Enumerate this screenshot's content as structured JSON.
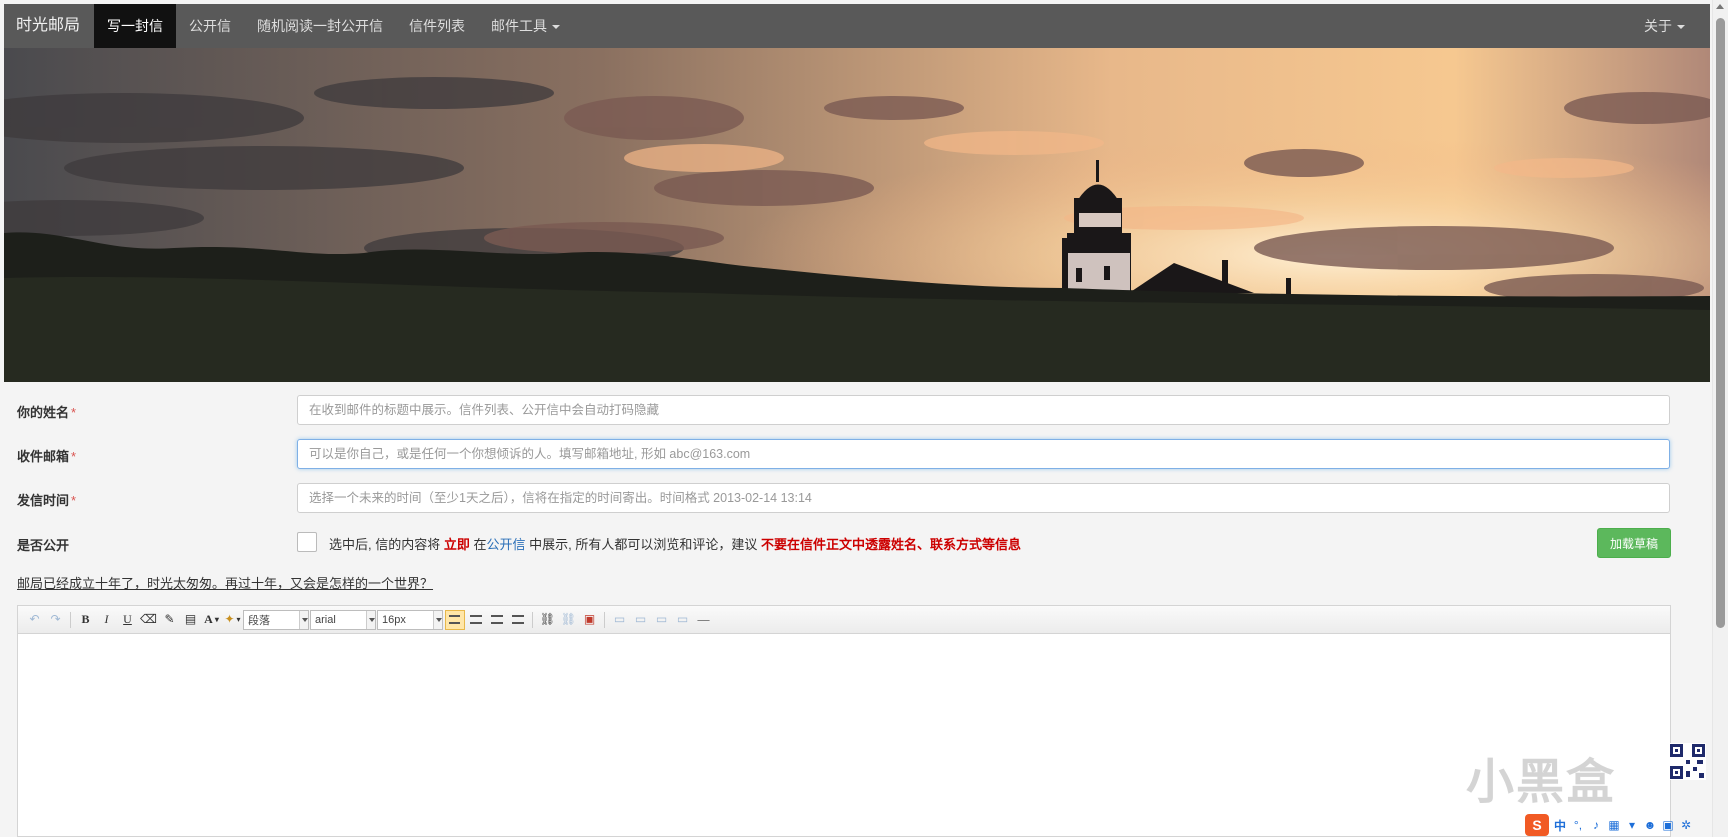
{
  "nav": {
    "brand": "时光邮局",
    "items": [
      "写一封信",
      "公开信",
      "随机阅读一封公开信",
      "信件列表",
      "邮件工具"
    ],
    "right": "关于"
  },
  "form": {
    "name_label": "你的姓名",
    "name_placeholder": "在收到邮件的标题中展示。信件列表、公开信中会自动打码隐藏",
    "email_label": "收件邮箱",
    "email_placeholder": "可以是你自己，或是任何一个你想倾诉的人。填写邮箱地址, 形如 abc@163.com",
    "time_label": "发信时间",
    "time_placeholder": "选择一个未来的时间（至少1天之后），信将在指定的时间寄出。时间格式 2013-02-14 13:14",
    "public_label": "是否公开",
    "required_mark": "*",
    "public_note_1": "选中后, 信的内容将",
    "public_note_now": "立即",
    "public_note_2": "在",
    "public_note_link": "公开信",
    "public_note_3": "中展示, 所有人都可以浏览和评论，建议",
    "public_note_warn": "不要在信件正文中透露姓名、联系方式等信息",
    "draft_button": "加载草稿",
    "tagline": "邮局已经成立十年了，时光太匆匆。再过十年，又会是怎样的一个世界？"
  },
  "editor": {
    "paragraph": "段落",
    "font": "arial",
    "size": "16px",
    "bold": "B",
    "italic": "I",
    "underline": "U",
    "fontcolor": "A"
  },
  "watermark": "小黑盒",
  "ime": {
    "logo": "S",
    "lang": "中"
  },
  "colors": {
    "navbar": "#595959",
    "active_tab": "#111111",
    "draft_button": "#5cb85c",
    "warn_text": "#cc0000",
    "link_text": "#2a6fb8"
  }
}
